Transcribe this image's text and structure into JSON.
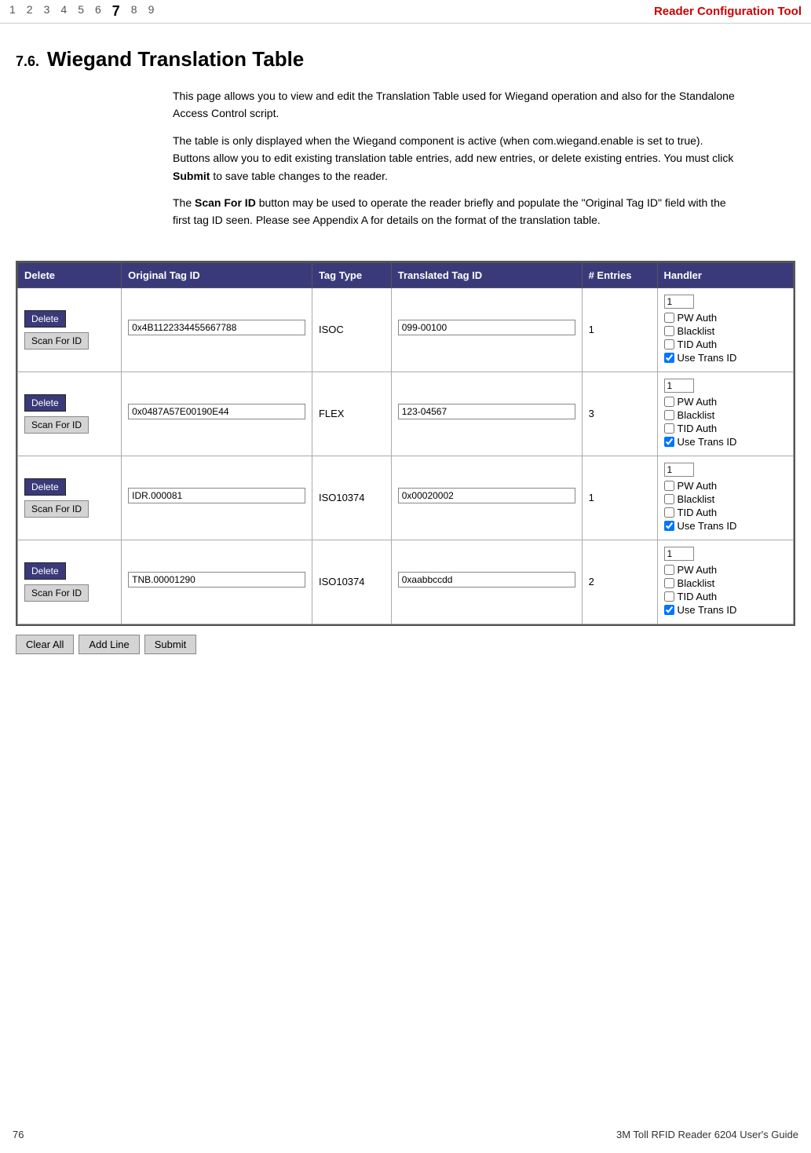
{
  "nav": {
    "numbers": [
      "1",
      "2",
      "3",
      "4",
      "5",
      "6",
      "7",
      "8",
      "9"
    ],
    "active": "7",
    "title": "Reader Configuration Tool"
  },
  "section": {
    "number": "7.6.",
    "title": "Wiegand Translation Table",
    "desc1": "This page allows you to view and edit the Translation Table used for Wiegand operation and also for the Standalone Access Control script.",
    "desc2": "The table is only displayed when the Wiegand component is active (when com.wiegand.enable is set to true).  Buttons allow you to edit existing translation table entries, add new entries, or delete existing entries.  You must click Submit to save table changes to the reader.",
    "desc2_bold": "Submit",
    "desc3_pre": "The ",
    "desc3_bold": "Scan For ID",
    "desc3_post": " button may be used to operate the reader briefly and populate the \"Original Tag ID\" field with the first tag ID seen.  Please see Appendix A for details on the format of the translation table."
  },
  "table": {
    "headers": [
      "Delete",
      "Original Tag ID",
      "Tag Type",
      "Translated Tag ID",
      "# Entries",
      "Handler"
    ],
    "rows": [
      {
        "delete_label": "Delete",
        "scan_label": "Scan For ID",
        "original_tag_id": "0x4B1122334455667788",
        "tag_type": "ISOC",
        "translated_tag_id": "099-00100",
        "num_entries": "1",
        "handler_value": "1",
        "pw_auth": false,
        "blacklist": false,
        "tid_auth": false,
        "use_trans_id": true
      },
      {
        "delete_label": "Delete",
        "scan_label": "Scan For ID",
        "original_tag_id": "0x0487A57E00190E44",
        "tag_type": "FLEX",
        "translated_tag_id": "123-04567",
        "num_entries": "3",
        "handler_value": "1",
        "pw_auth": false,
        "blacklist": false,
        "tid_auth": false,
        "use_trans_id": true
      },
      {
        "delete_label": "Delete",
        "scan_label": "Scan For ID",
        "original_tag_id": "IDR.000081",
        "tag_type": "ISO10374",
        "translated_tag_id": "0x00020002",
        "num_entries": "1",
        "handler_value": "1",
        "pw_auth": false,
        "blacklist": false,
        "tid_auth": false,
        "use_trans_id": true
      },
      {
        "delete_label": "Delete",
        "scan_label": "Scan For ID",
        "original_tag_id": "TNB.00001290",
        "tag_type": "ISO10374",
        "translated_tag_id": "0xaabbccdd",
        "num_entries": "2",
        "handler_value": "1",
        "pw_auth": false,
        "blacklist": false,
        "tid_auth": false,
        "use_trans_id": true
      }
    ],
    "handler_labels": {
      "pw_auth": "PW Auth",
      "blacklist": "Blacklist",
      "tid_auth": "TID Auth",
      "use_trans_id": "Use Trans ID"
    }
  },
  "bottom_buttons": {
    "clear_all": "Clear All",
    "add_line": "Add Line",
    "submit": "Submit"
  },
  "footer": {
    "page_number": "76",
    "doc_title": "3M Toll RFID Reader 6204 User's Guide"
  }
}
